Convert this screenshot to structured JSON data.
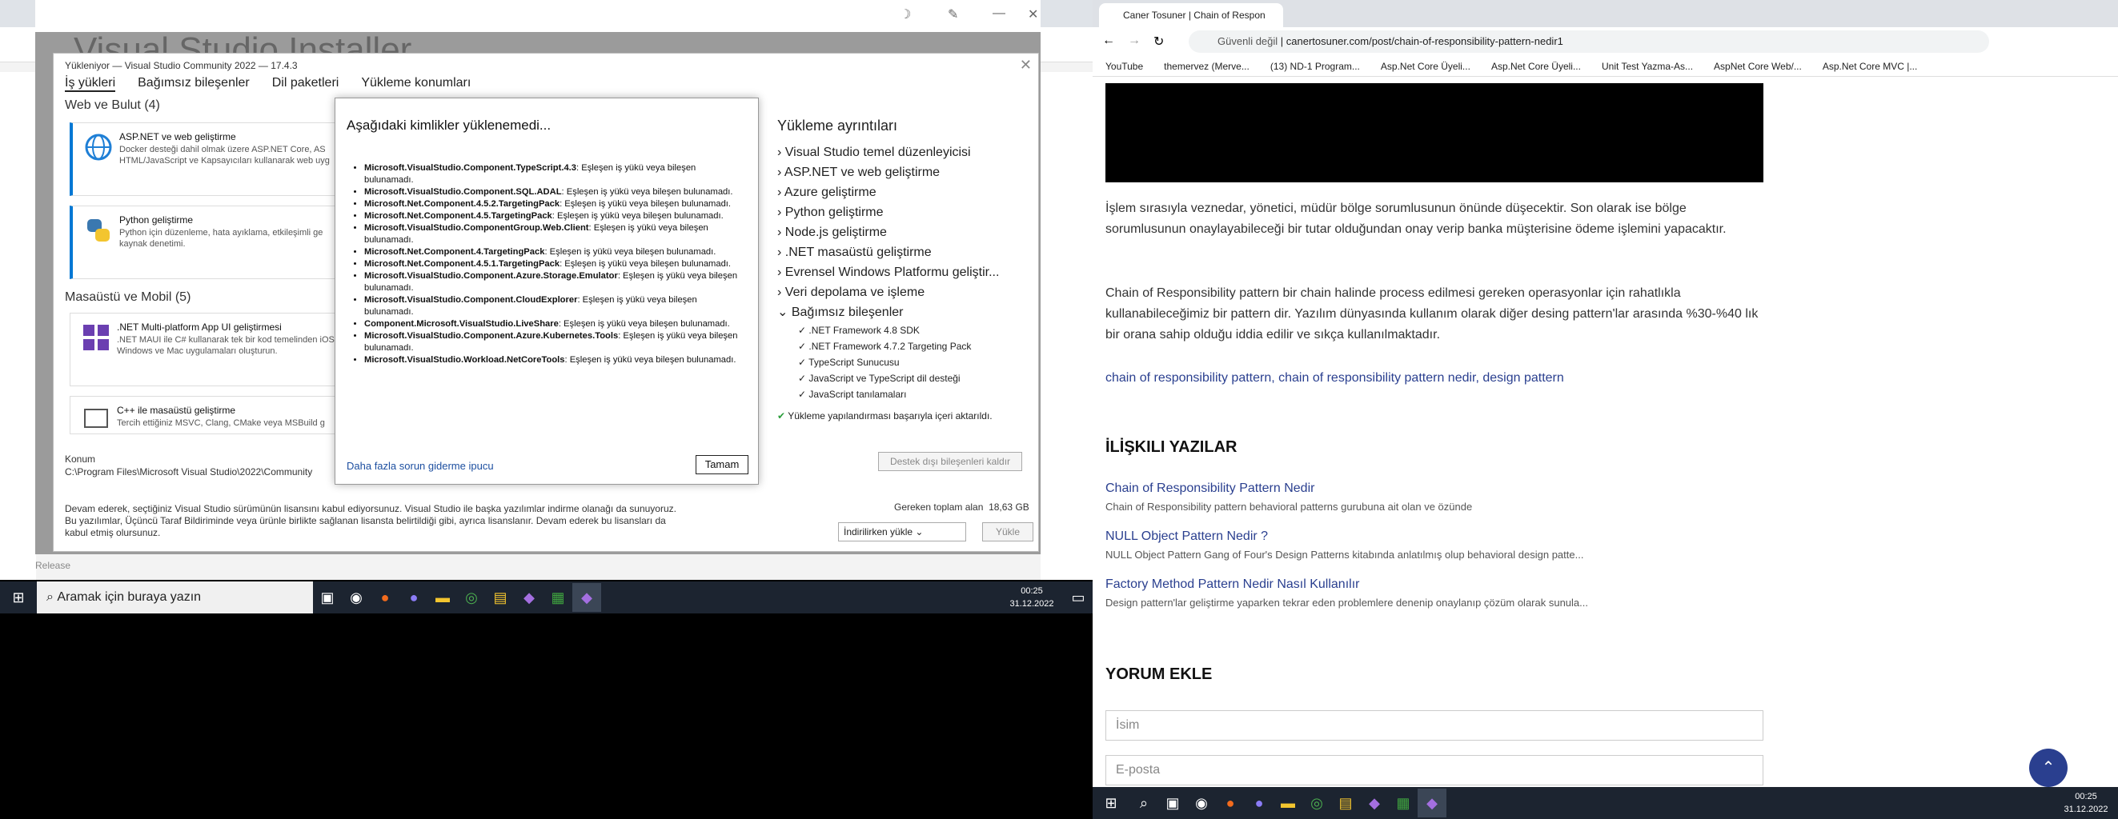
{
  "vs": {
    "title": "Visual Studio Installer",
    "subtitle": "Yükleniyor — Visual Studio Community 2022 — 17.4.3",
    "tabs": [
      "İş yükleri",
      "Bağımsız bileşenler",
      "Dil paketleri",
      "Yükleme konumları"
    ],
    "section_web": "Web ve Bulut (4)",
    "section_desktop": "Masaüstü ve Mobil (5)",
    "cards": [
      {
        "title": "ASP.NET ve web geliştirme",
        "desc": "Docker desteği dahil olmak üzere ASP.NET Core, AS HTML/JavaScript ve Kapsayıcıları kullanarak web uyg"
      },
      {
        "title": "Python geliştirme",
        "desc": "Python için düzenleme, hata ayıklama, etkileşimli ge kaynak denetimi."
      },
      {
        "title": ".NET Multi-platform App UI geliştirmesi",
        "desc": ".NET MAUI ile C# kullanarak tek bir kod temelinden iOS, Windows ve Mac uygulamaları oluşturun."
      },
      {
        "title": "C++ ile masaüstü geliştirme",
        "desc": "Tercih ettiğiniz MSVC, Clang, CMake veya MSBuild g"
      }
    ],
    "details_title": "Yükleme ayrıntıları",
    "details": [
      "Visual Studio temel düzenleyicisi",
      "ASP.NET ve web geliştirme",
      "Azure geliştirme",
      "Python geliştirme",
      "Node.js geliştirme",
      ".NET masaüstü geliştirme",
      "Evrensel Windows Platformu geliştir...",
      "Veri depolama ve işleme",
      "Bağımsız bileşenler"
    ],
    "details_sub": [
      ".NET Framework 4.8 SDK",
      ".NET Framework 4.7.2 Targeting Pack",
      "TypeScript Sunucusu",
      "JavaScript ve TypeScript dil desteği",
      "JavaScript tanılamaları"
    ],
    "import_msg": "Yükleme yapılandırması başarıyla içeri aktarıldı.",
    "location_label": "Konum",
    "location_path": "C:\\Program Files\\Microsoft Visual Studio\\2022\\Community",
    "remove_btn": "Destek dışı bileşenleri kaldır",
    "license_text": "Devam ederek, seçtiğiniz Visual Studio sürümünün lisansını kabul ediyorsunuz. Visual Studio ile başka yazılımlar indirme olanağı da sunuyoruz. Bu yazılımlar, Üçüncü Taraf Bildiriminde veya ürünle birlikte sağlanan lisansta belirtildiği gibi, ayrıca lisanslanır. Devam ederek bu lisansları da kabul etmiş olursunuz.",
    "total_label": "Gereken toplam alan",
    "total_value": "18,63 GB",
    "mode": "İndirilirken yükle",
    "install_btn": "Yükle",
    "release": "Release"
  },
  "error": {
    "title": "Aşağıdaki kimlikler yüklenemedi...",
    "items": [
      {
        "id": "Microsoft.VisualStudio.Component.TypeScript.4.3",
        "msg": ": Eşleşen iş yükü veya bileşen bulunamadı."
      },
      {
        "id": "Microsoft.VisualStudio.Component.SQL.ADAL",
        "msg": ": Eşleşen iş yükü veya bileşen bulunamadı."
      },
      {
        "id": "Microsoft.Net.Component.4.5.2.TargetingPack",
        "msg": ": Eşleşen iş yükü veya bileşen bulunamadı."
      },
      {
        "id": "Microsoft.Net.Component.4.5.TargetingPack",
        "msg": ": Eşleşen iş yükü veya bileşen bulunamadı."
      },
      {
        "id": "Microsoft.VisualStudio.ComponentGroup.Web.Client",
        "msg": ": Eşleşen iş yükü veya bileşen bulunamadı."
      },
      {
        "id": "Microsoft.Net.Component.4.TargetingPack",
        "msg": ": Eşleşen iş yükü veya bileşen bulunamadı."
      },
      {
        "id": "Microsoft.Net.Component.4.5.1.TargetingPack",
        "msg": ": Eşleşen iş yükü veya bileşen bulunamadı."
      },
      {
        "id": "Microsoft.VisualStudio.Component.Azure.Storage.Emulator",
        "msg": ": Eşleşen iş yükü veya bileşen bulunamadı."
      },
      {
        "id": "Microsoft.VisualStudio.Component.CloudExplorer",
        "msg": ": Eşleşen iş yükü veya bileşen bulunamadı."
      },
      {
        "id": "Component.Microsoft.VisualStudio.LiveShare",
        "msg": ": Eşleşen iş yükü veya bileşen bulunamadı."
      },
      {
        "id": "Microsoft.VisualStudio.Component.Azure.Kubernetes.Tools",
        "msg": ": Eşleşen iş yükü veya bileşen bulunamadı."
      },
      {
        "id": "Microsoft.VisualStudio.Workload.NetCoreTools",
        "msg": ": Eşleşen iş yükü veya bileşen bulunamadı."
      }
    ],
    "link": "Daha fazla sorun giderme ipucu",
    "ok": "Tamam"
  },
  "taskbar_left": {
    "search": "Aramak için buraya yazın",
    "time": "00:25",
    "date": "31.12.2022"
  },
  "browser": {
    "tab_title": "Caner Tosuner | Chain of Respon",
    "security": "Güvenli değil",
    "url": "canertosuner.com/post/chain-of-responsibility-pattern-nedir1",
    "bookmarks": [
      "YouTube",
      "themervez (Merve...",
      "(13) ND-1 Program...",
      "Asp.Net Core Üyeli...",
      "Asp.Net Core Üyeli...",
      "Unit Test Yazma-As...",
      "AspNet Core Web/...",
      "Asp.Net Core MVC |..."
    ],
    "para1": "İşlem sırasıyla veznedar, yönetici, müdür bölge sorumlusunun önünde düşecektir. Son olarak ise bölge sorumlusunun onaylayabileceği bir tutar olduğundan onay verip banka müşterisine ödeme işlemini yapacaktır.",
    "para2": "Chain of Responsibility pattern bir chain halinde process edilmesi gereken operasyonlar için rahatlıkla kullanabileceğimiz bir pattern dir. Yazılım dünyasında kullanım olarak diğer desing pattern'lar arasında %30-%40 lık bir orana sahip olduğu iddia edilir ve sıkça kullanılmaktadır.",
    "tags": "chain of responsibility pattern, chain of responsibility pattern nedir, design pattern",
    "related_title": "İLİŞKILI YAZILAR",
    "related": [
      {
        "title": "Chain of Responsibility Pattern Nedir",
        "desc": "Chain of Responsibility pattern behavioral patterns gurubuna ait olan ve özünde"
      },
      {
        "title": "NULL Object Pattern Nedir ?",
        "desc": "NULL Object Pattern Gang of Four's Design Patterns kitabında anlatılmış olup behavioral design patte..."
      },
      {
        "title": "Factory Method Pattern Nedir Nasıl Kullanılır",
        "desc": "Design pattern'lar geliştirme yaparken tekrar eden problemlere denenip onaylanıp çözüm olarak sunula..."
      }
    ],
    "comment_title": "YORUM EKLE",
    "name_placeholder": "İsim",
    "email_placeholder": "E-posta"
  },
  "taskbar_right": {
    "time": "00:25",
    "date": "31.12.2022"
  }
}
